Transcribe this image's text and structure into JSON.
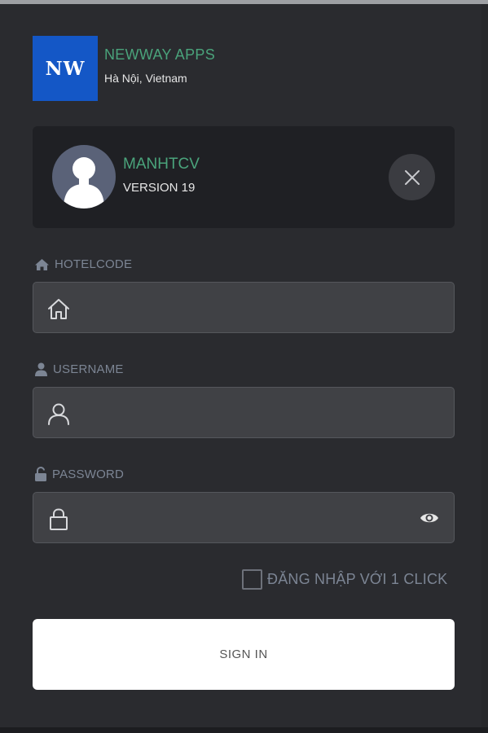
{
  "brand": {
    "logo_text": "NW",
    "name": "NEWWAY APPS",
    "location": "Hà Nội, Vietnam",
    "logo_color": "#1457c6",
    "accent_color": "#4aa37b"
  },
  "account": {
    "username": "MANHTCV",
    "version": "VERSION 19",
    "avatar_icon": "user-silhouette-icon",
    "close_icon": "close-icon"
  },
  "form": {
    "hotelcode": {
      "label": "HOTELCODE",
      "label_icon": "home-icon",
      "field_icon": "house-outline-icon",
      "value": ""
    },
    "username": {
      "label": "USERNAME",
      "label_icon": "user-icon",
      "field_icon": "user-outline-icon",
      "value": ""
    },
    "password": {
      "label": "PASSWORD",
      "label_icon": "unlock-icon",
      "field_icon": "lock-outline-icon",
      "value": "",
      "toggle_icon": "eye-icon"
    },
    "remember_label": "ĐĂNG NHẬP VỚI 1 CLICK",
    "remember_checked": false,
    "submit_label": "SIGN IN"
  }
}
